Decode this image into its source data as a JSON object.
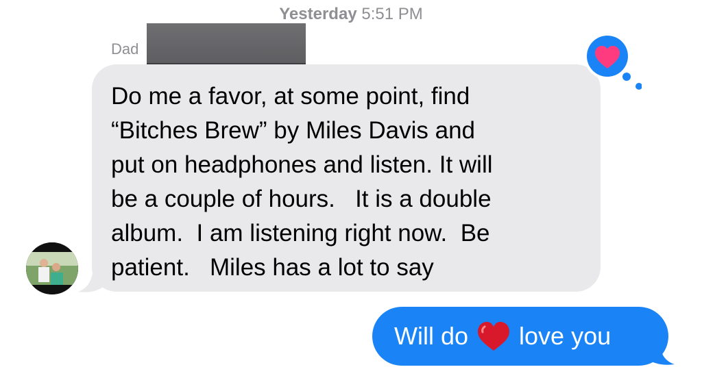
{
  "timestamp": {
    "day": "Yesterday",
    "time": "5:51 PM"
  },
  "sender": {
    "name": "Dad"
  },
  "incoming": {
    "text": "Do me a favor, at some point, find\n“Bitches Brew” by Miles Davis and\nput on headphones and listen. It will\nbe a couple of hours.   It is a double\nalbum.  I am listening right now.  Be\npatient.   Miles has a lot to say"
  },
  "tapback": {
    "icon": "heart-icon",
    "color": "#ff3b7f",
    "bubble_color": "#1a84f7"
  },
  "outgoing": {
    "text_before": "Will do",
    "emoji": "red-heart",
    "text_after": "love you"
  },
  "colors": {
    "incoming_bubble": "#e9e9eb",
    "outgoing_bubble": "#1a84f7",
    "meta_text": "#8e8e93"
  }
}
